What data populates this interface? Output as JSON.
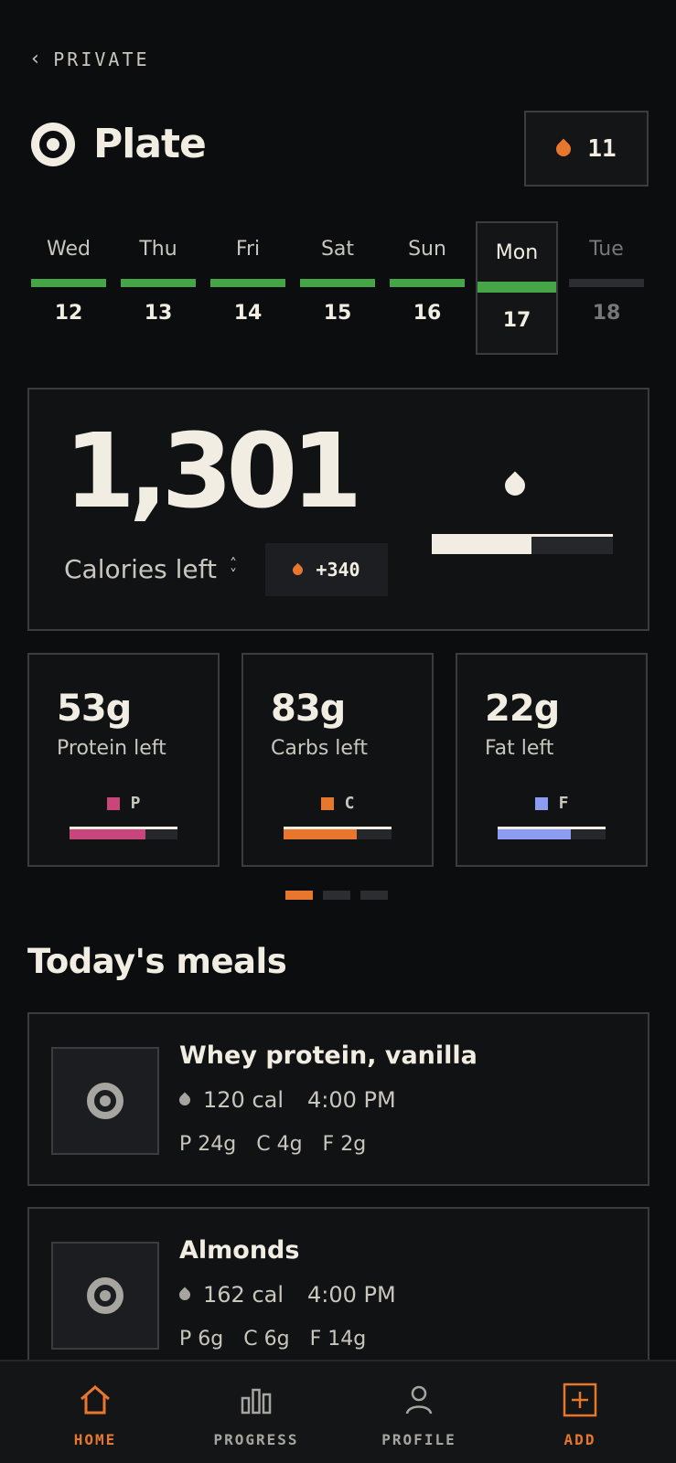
{
  "header": {
    "back_label": "PRIVATE",
    "back_icon": "chevron-left-icon",
    "app_title": "Plate",
    "streak_count": "11",
    "streak_icon": "flame-icon"
  },
  "week": [
    {
      "name": "Wed",
      "date": "12",
      "state": "complete"
    },
    {
      "name": "Thu",
      "date": "13",
      "state": "complete"
    },
    {
      "name": "Fri",
      "date": "14",
      "state": "complete"
    },
    {
      "name": "Sat",
      "date": "15",
      "state": "complete"
    },
    {
      "name": "Sun",
      "date": "16",
      "state": "complete"
    },
    {
      "name": "Mon",
      "date": "17",
      "state": "selected"
    },
    {
      "name": "Tue",
      "date": "18",
      "state": "future"
    }
  ],
  "calories": {
    "value": "1,301",
    "label": "Calories left",
    "burned": "+340",
    "progress_fraction": 0.55
  },
  "macros": [
    {
      "amount": "53g",
      "label": "Protein left",
      "key": "P",
      "color": "#c8467b",
      "progress_fraction": 0.7
    },
    {
      "amount": "83g",
      "label": "Carbs left",
      "key": "C",
      "color": "#e8772e",
      "progress_fraction": 0.68
    },
    {
      "amount": "22g",
      "label": "Fat left",
      "key": "F",
      "color": "#8b9cf2",
      "progress_fraction": 0.68
    }
  ],
  "pager": {
    "pages": 3,
    "active": 0
  },
  "meals_section": {
    "title": "Today's meals"
  },
  "meals": [
    {
      "name": "Whey protein, vanilla",
      "calories": "120 cal",
      "time": "4:00 PM",
      "protein": "P 24g",
      "carbs": "C 4g",
      "fat": "F 2g"
    },
    {
      "name": "Almonds",
      "calories": "162 cal",
      "time": "4:00 PM",
      "protein": "P 6g",
      "carbs": "C 6g",
      "fat": "F 14g"
    }
  ],
  "nav": {
    "home": "HOME",
    "progress": "PROGRESS",
    "profile": "PROFILE",
    "add": "ADD"
  },
  "colors": {
    "accent": "#e8772e",
    "complete": "#45a547",
    "background": "#0c0d0f"
  }
}
